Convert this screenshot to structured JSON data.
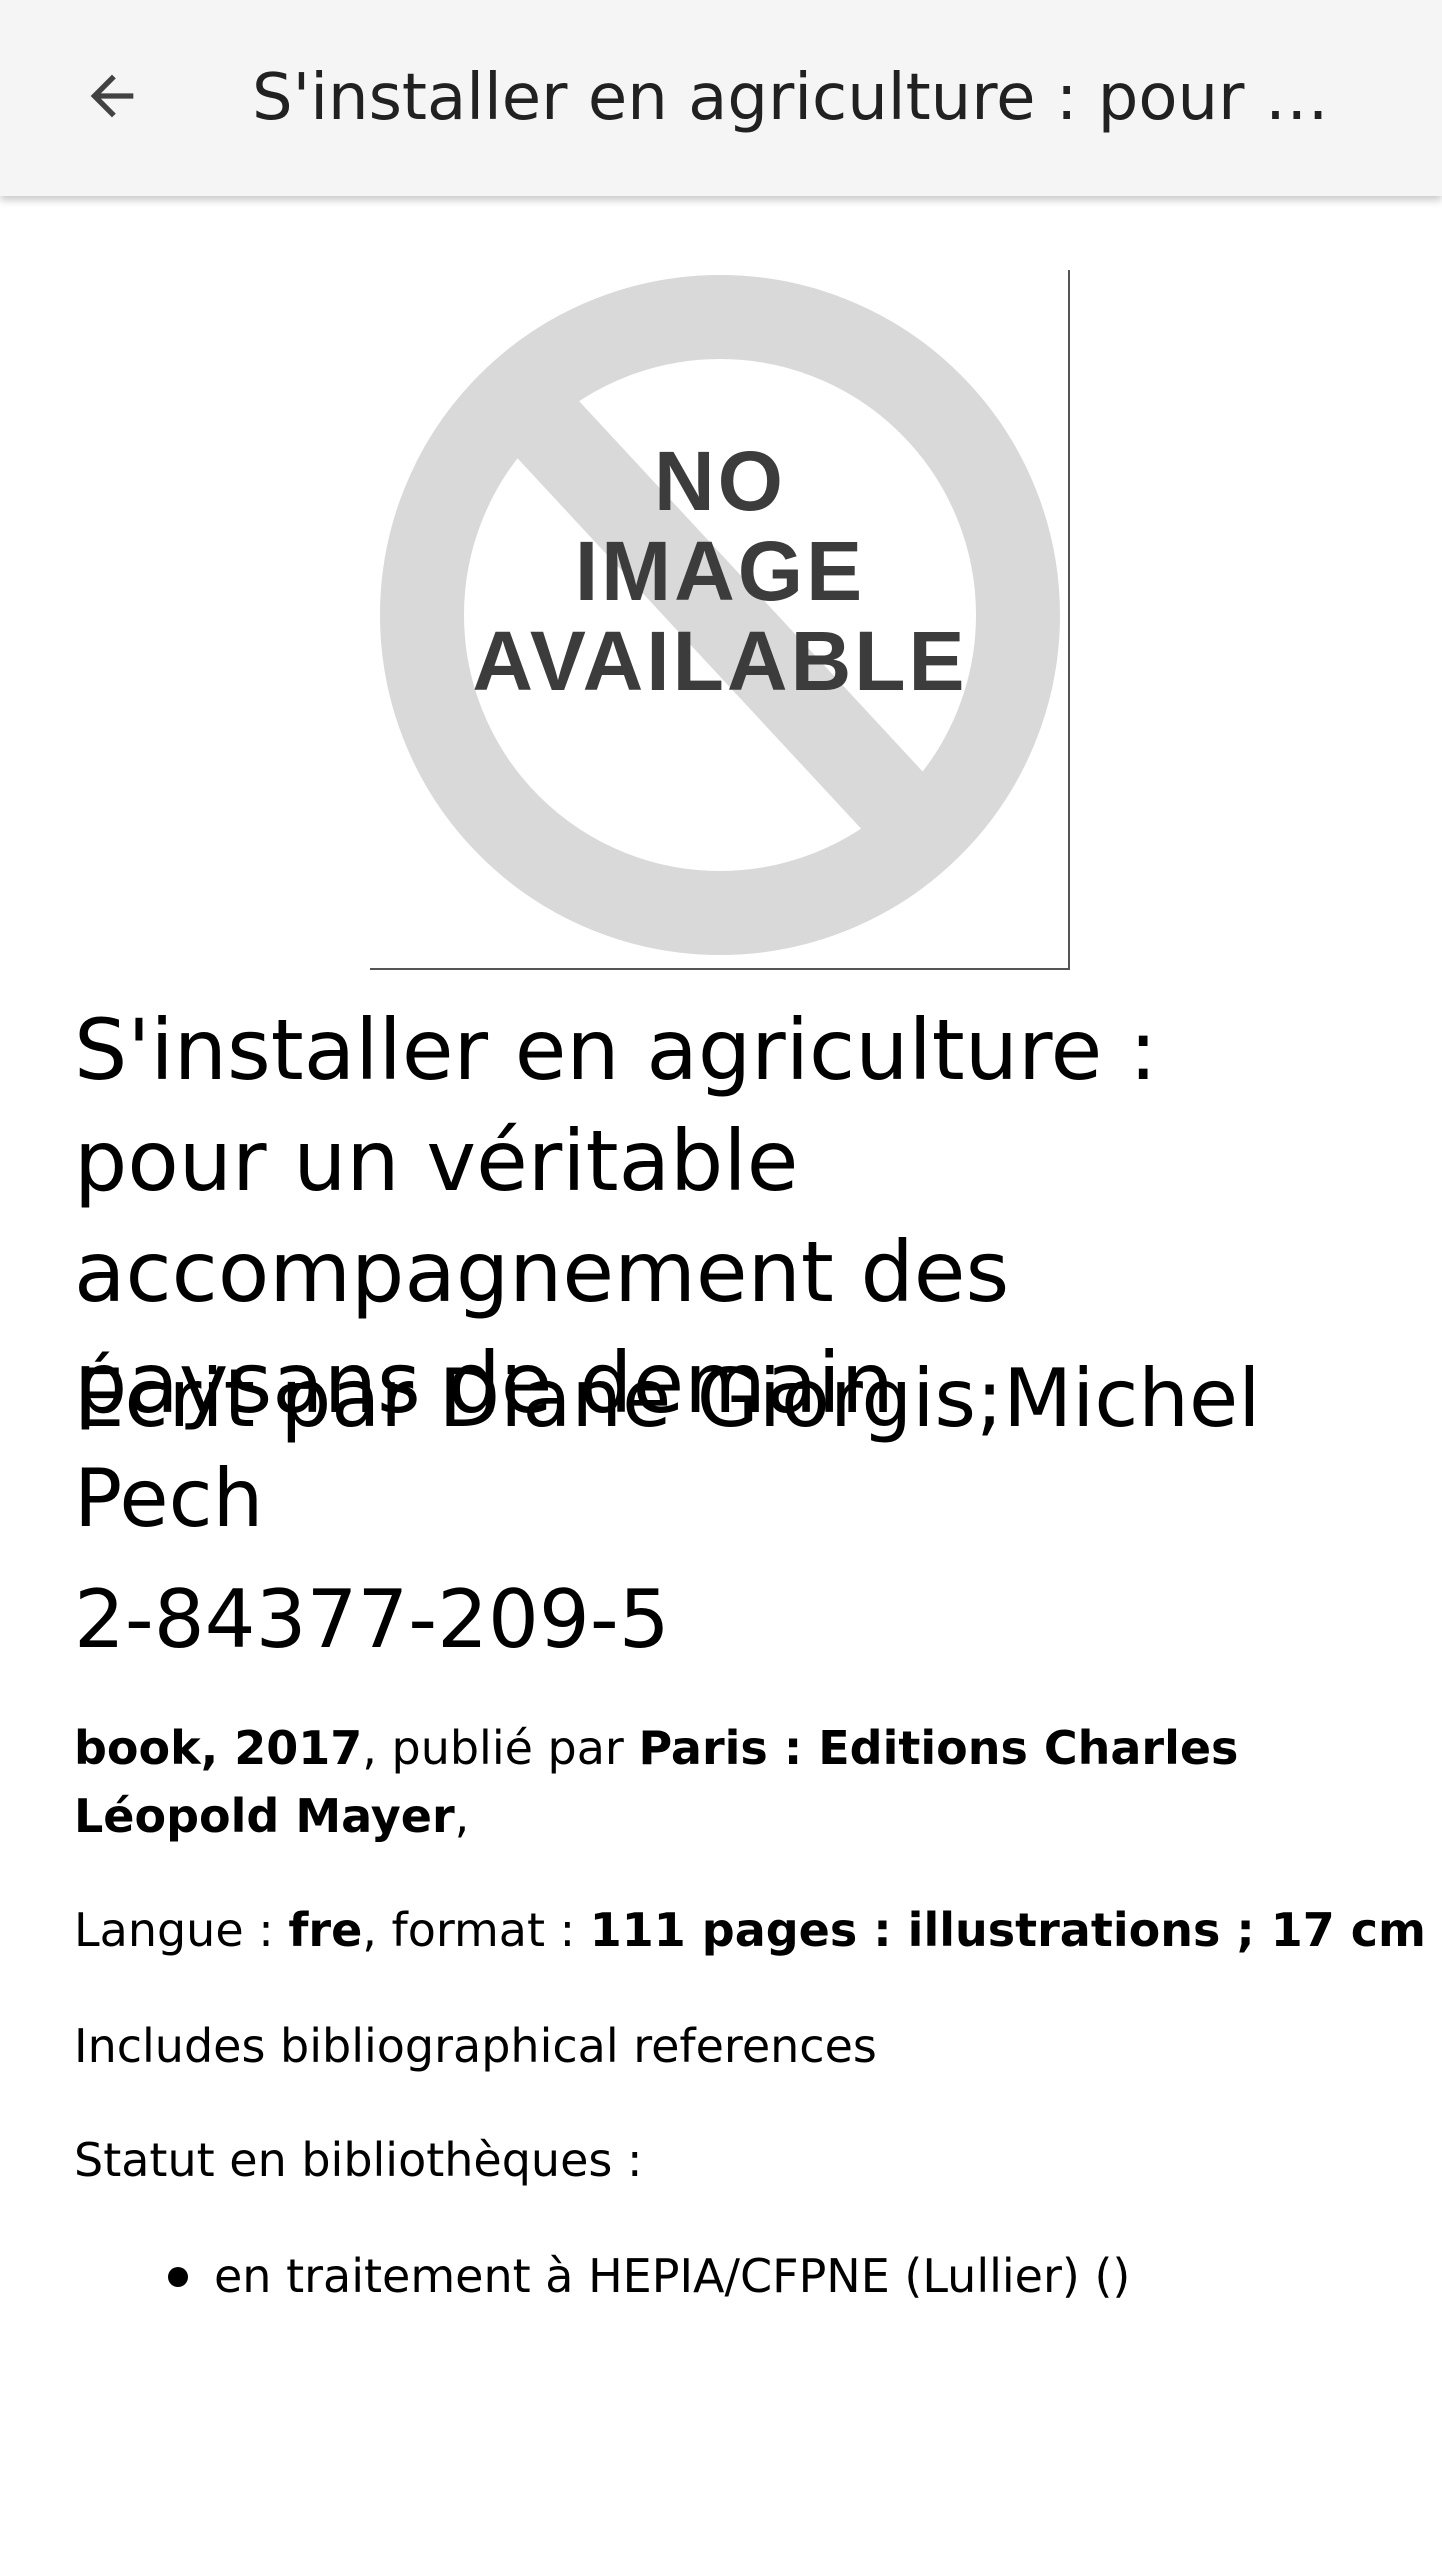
{
  "appbar": {
    "back_icon": "arrow-back-icon",
    "title": "S'installer en agriculture : pour un véritable accompagnement des paysans de demain"
  },
  "cover": {
    "placeholder_icon": "no-image-icon",
    "line1": "NO",
    "line2": "IMAGE",
    "line3": "AVAILABLE"
  },
  "book": {
    "title": "S'installer en agriculture : pour un véritable accompagnement des paysans de demain",
    "author": "Écrit par Diane Giorgis;Michel Pech",
    "isbn": "2-84377-209-5",
    "publication": {
      "type_year": "book, 2017",
      "published_by_label": ", publié par ",
      "publisher": "Paris : Editions Charles Léopold Mayer",
      "trailing": ","
    },
    "format_line": {
      "language_label": "Langue : ",
      "language": "fre",
      "format_label": ", format : ",
      "format": "111 pages : illustrations ; 17 cm"
    },
    "note": "Includes bibliographical references",
    "status_label": "Statut en bibliothèques :",
    "status_items": [
      "en traitement à HEPIA/CFPNE (Lullier) ()"
    ]
  },
  "colors": {
    "appbar_bg": "#f5f5f5",
    "placeholder_gray": "#d9d9d9",
    "placeholder_text": "#3c3c3c"
  }
}
